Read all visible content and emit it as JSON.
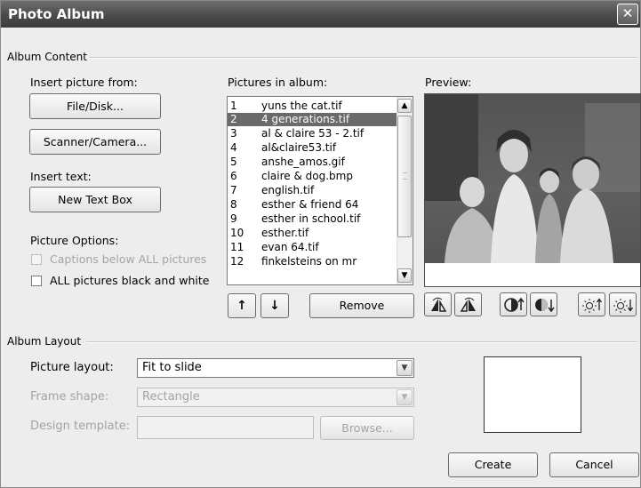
{
  "window": {
    "title": "Photo Album",
    "close_glyph": "✕"
  },
  "album_content": {
    "group_label": "Album Content",
    "insert_picture_label": "Insert picture from:",
    "file_disk_button": "File/Disk...",
    "scanner_camera_button": "Scanner/Camera...",
    "insert_text_label": "Insert text:",
    "new_text_box_button": "New Text Box",
    "picture_options_label": "Picture Options:",
    "captions_checkbox": {
      "label": "Captions below ALL pictures",
      "checked": false,
      "enabled": false
    },
    "black_white_checkbox": {
      "label": "ALL pictures black and white",
      "checked": false,
      "enabled": true
    },
    "pictures_label": "Pictures in album:",
    "pictures": [
      {
        "num": "1",
        "name": "yuns the cat.tif"
      },
      {
        "num": "2",
        "name": "4 generations.tif"
      },
      {
        "num": "3",
        "name": "al & claire 53 - 2.tif"
      },
      {
        "num": "4",
        "name": "al&claire53.tif"
      },
      {
        "num": "5",
        "name": "anshe_amos.gif"
      },
      {
        "num": "6",
        "name": "claire & dog.bmp"
      },
      {
        "num": "7",
        "name": "english.tif"
      },
      {
        "num": "8",
        "name": "esther & friend 64"
      },
      {
        "num": "9",
        "name": "esther in school.tif"
      },
      {
        "num": "10",
        "name": "esther.tif"
      },
      {
        "num": "11",
        "name": "evan 64.tif"
      },
      {
        "num": "12",
        "name": "finkelsteins on mr"
      }
    ],
    "selected_index": 1,
    "move_up_glyph": "↑",
    "move_down_glyph": "↓",
    "remove_button": "Remove",
    "preview_label": "Preview:",
    "preview_tools": [
      "rotate-left-icon",
      "rotate-right-icon",
      "contrast-up-icon",
      "contrast-down-icon",
      "brightness-up-icon",
      "brightness-down-icon"
    ]
  },
  "album_layout": {
    "group_label": "Album Layout",
    "picture_layout_label": "Picture layout:",
    "picture_layout_value": "Fit to slide",
    "frame_shape_label": "Frame shape:",
    "frame_shape_value": "Rectangle",
    "design_template_label": "Design template:",
    "design_template_value": "",
    "browse_button": "Browse..."
  },
  "actions": {
    "create": "Create",
    "cancel": "Cancel"
  },
  "colors": {
    "titlebar": "#4a4a4a",
    "selection": "#6a6a6a",
    "dialog_bg": "#ededed"
  }
}
